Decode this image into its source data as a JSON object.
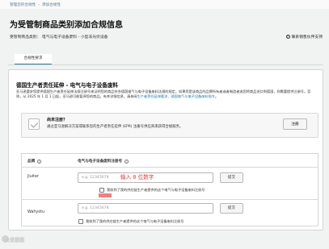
{
  "breadcrumb": {
    "home": "管理您的合规性",
    "current": "添加合规性"
  },
  "page": {
    "title": "为受管制商品类别添加合规信息",
    "category": "受管制商品类别：   电气与电子设备废料 - 小型非光伏设备",
    "support_link": "联系销售伙伴支持"
  },
  "tabs": [
    {
      "label": "合规性要求"
    }
  ],
  "section": {
    "title": "德国生产者责任延伸 - 电气与电子设备废料",
    "desc_main": "亚马逊要求您提供德国生产者责任延伸法规注册号来证明您的商品符合德国电气与电子设备废料法规的规定。如果您是该商品的品牌所有者或者制造者或您将商品进口到德国，则需要提供注册号。否则，从 2025 年 1 月 1 日起，亚马逊可能暂停您的商品。有关详细信息，请参阅",
    "desc_link1": "生产者责任延伸要求",
    "desc_sep": "、",
    "desc_link2": "德国电气与电子设备废料指令",
    "desc_end": "。"
  },
  "notice": {
    "title": "尚未注册？",
    "text": "通过亚马逊解决方案或联系您的生产者责任延伸 (EPR) 注册号供应商来获得合规服务。",
    "button": "注册"
  },
  "table": {
    "col_brand": "品牌",
    "col_epr": "电气与电子设备废料注册号",
    "rows": [
      {
        "brand": "Jiuiter",
        "placeholder": "e.g. 12345678",
        "submit": "提交",
        "checkbox_label": "我收到了我的供应链生产者提供的这个电气与电子设备废料注册号"
      },
      {
        "brand": "Wahyotu",
        "placeholder": "e.g. 12345678",
        "submit": "提交",
        "checkbox_label": "我收到了我的供应链生产者提供的这个电气与电子设备废料注册号"
      }
    ],
    "hint": "输入 8 位数字"
  },
  "watermark": "大爱圆圆"
}
